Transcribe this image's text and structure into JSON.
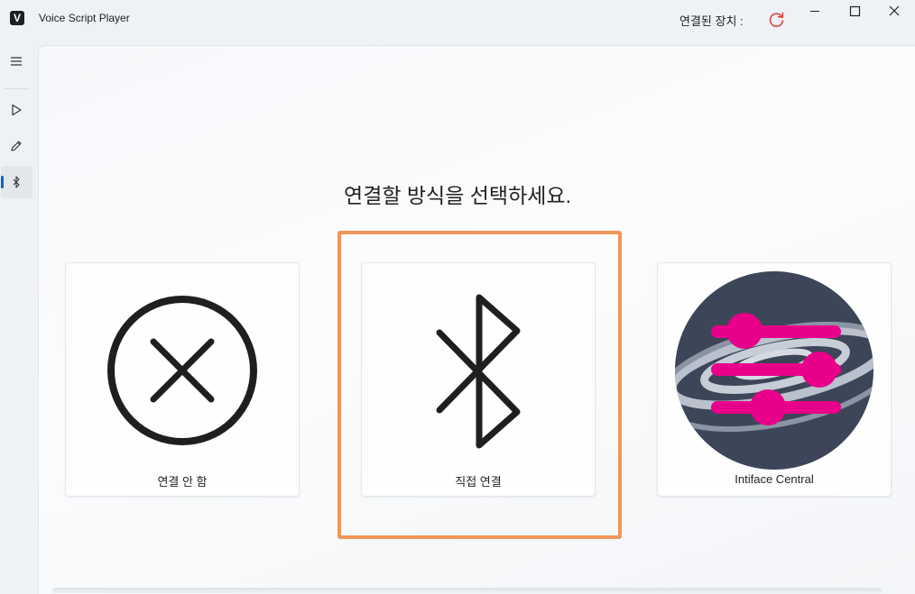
{
  "app": {
    "logo_letter": "V",
    "title": "Voice Script Player"
  },
  "header": {
    "device_label": "연결된 장치 :",
    "refresh_color": "#e0453a"
  },
  "window_controls": {
    "minimize": "—",
    "maximize": "☐",
    "close": "✕"
  },
  "sidebar": {
    "items": [
      {
        "icon": "menu-icon"
      },
      {
        "icon": "play-icon"
      },
      {
        "icon": "pencil-icon"
      },
      {
        "icon": "bluetooth-icon",
        "selected": true
      }
    ]
  },
  "main": {
    "heading": "연결할 방식을 선택하세요.",
    "options": [
      {
        "label": "연결 안 함",
        "icon": "close-circle-icon"
      },
      {
        "label": "직접 연결",
        "icon": "bluetooth-icon",
        "highlighted": true
      },
      {
        "label": "Intiface Central",
        "icon": "intiface-logo"
      }
    ]
  },
  "colors": {
    "accent": "#0a64c8",
    "highlight": "#f0965a",
    "intiface_pink": "#e8008a",
    "intiface_bg": "#3d4658"
  }
}
